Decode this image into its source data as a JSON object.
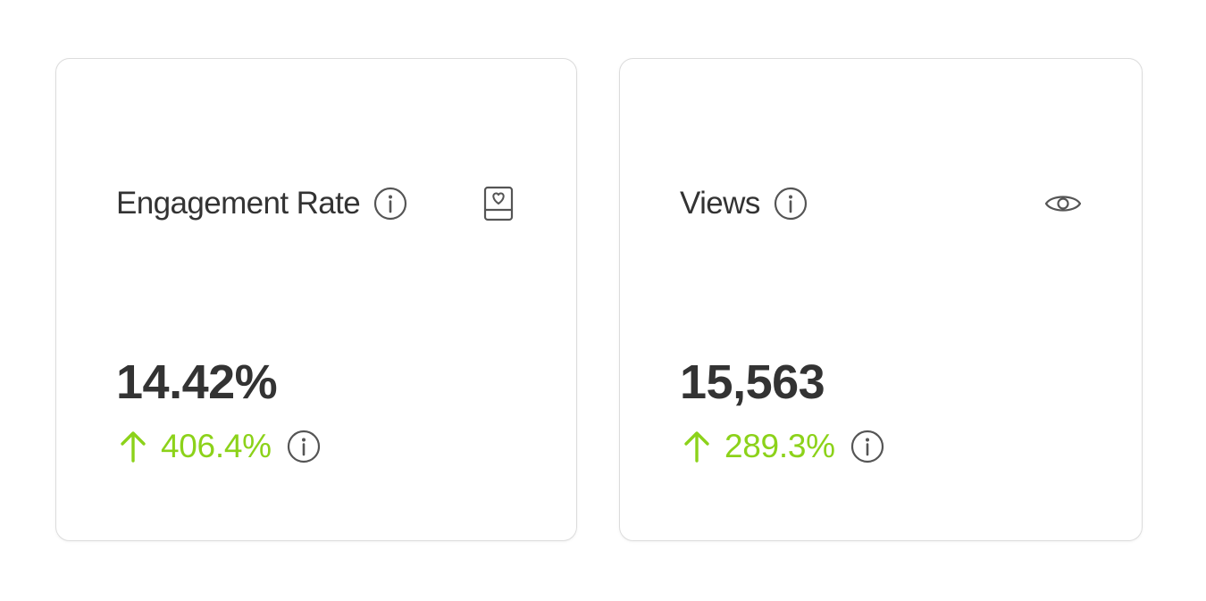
{
  "colors": {
    "accent_positive": "#8cd21a",
    "text": "#333333",
    "card_border": "#dcdcdc",
    "icon": "#555555"
  },
  "cards": [
    {
      "title": "Engagement Rate",
      "title_icon": "info-icon",
      "corner_icon": "heart-card-icon",
      "value": "14.42%",
      "change": "406.4%",
      "change_direction": "up",
      "change_icon": "info-icon"
    },
    {
      "title": "Views",
      "title_icon": "info-icon",
      "corner_icon": "eye-icon",
      "value": "15,563",
      "change": "289.3%",
      "change_direction": "up",
      "change_icon": "info-icon"
    }
  ]
}
